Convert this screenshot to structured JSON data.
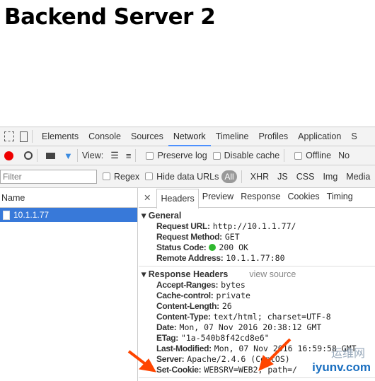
{
  "page": {
    "title": "Backend Server 2"
  },
  "devtools": {
    "tabs": [
      "Elements",
      "Console",
      "Sources",
      "Network",
      "Timeline",
      "Profiles",
      "Application",
      "S"
    ],
    "active_tab": "Network",
    "toolbar": {
      "view_label": "View:",
      "preserve_log": "Preserve log",
      "disable_cache": "Disable cache",
      "offline": "Offline",
      "no": "No"
    },
    "filter": {
      "placeholder": "Filter",
      "regex": "Regex",
      "hide_data_urls": "Hide data URLs",
      "types": [
        "All",
        "XHR",
        "JS",
        "CSS",
        "Img",
        "Media"
      ]
    },
    "requests": {
      "header": "Name",
      "items": [
        "10.1.1.77"
      ]
    },
    "detail_tabs": [
      "Headers",
      "Preview",
      "Response",
      "Cookies",
      "Timing"
    ],
    "general": {
      "title": "General",
      "rows": [
        {
          "k": "Request URL:",
          "v": "http://10.1.1.77/"
        },
        {
          "k": "Request Method:",
          "v": "GET"
        },
        {
          "k": "Status Code:",
          "v": "200 OK"
        },
        {
          "k": "Remote Address:",
          "v": "10.1.1.77:80"
        }
      ]
    },
    "response_headers": {
      "title": "Response Headers",
      "view_source": "view source",
      "rows": [
        {
          "k": "Accept-Ranges:",
          "v": "bytes"
        },
        {
          "k": "Cache-control:",
          "v": "private"
        },
        {
          "k": "Content-Length:",
          "v": "26"
        },
        {
          "k": "Content-Type:",
          "v": "text/html; charset=UTF-8"
        },
        {
          "k": "Date:",
          "v": "Mon, 07 Nov 2016 20:38:12 GMT"
        },
        {
          "k": "ETag:",
          "v": "\"1a-540b8f42cd8e6\""
        },
        {
          "k": "Last-Modified:",
          "v": "Mon, 07 Nov 2016 16:59:58 GMT"
        },
        {
          "k": "Server:",
          "v": "Apache/2.4.6 (CentOS)"
        },
        {
          "k": "Set-Cookie:",
          "v": "WEBSRV=WEB2; path=/"
        }
      ]
    },
    "status_color": "#2fb82f",
    "accent": "#4d90fe",
    "annotation_color": "#ff4500"
  },
  "watermark": {
    "cn": "运维网",
    "en": "iyunv.com"
  }
}
